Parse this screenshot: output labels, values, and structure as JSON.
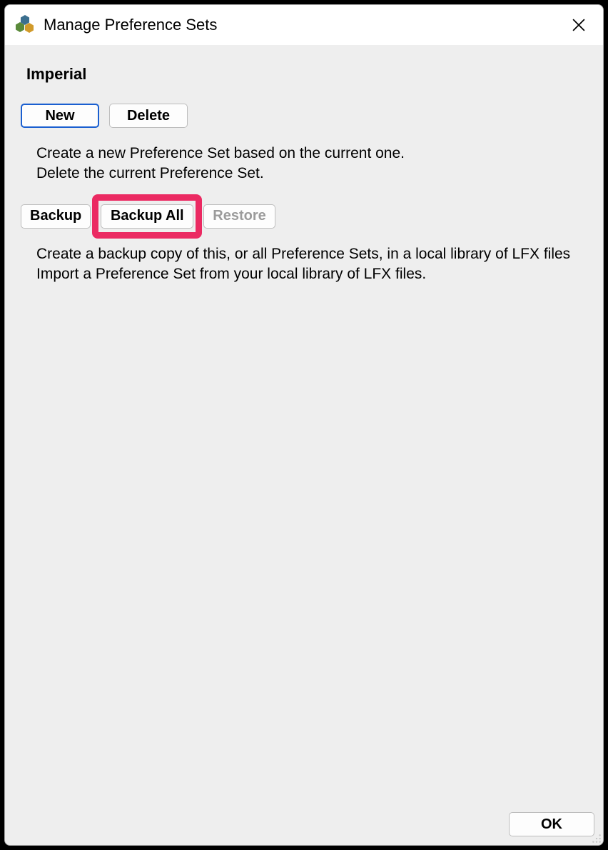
{
  "window": {
    "title": "Manage Preference Sets"
  },
  "section": {
    "current_set": "Imperial"
  },
  "buttons": {
    "new": "New",
    "delete": "Delete",
    "backup": "Backup",
    "backup_all": "Backup All",
    "restore": "Restore",
    "ok": "OK"
  },
  "descriptions": {
    "new_delete": "Create a new Preference Set based on the current one.\nDelete the current Preference Set.",
    "backup_restore": "Create a backup copy of this, or all Preference Sets, in a local library of LFX files\nImport a Preference Set from your local library of LFX files."
  },
  "highlight": {
    "target": "backup_all"
  }
}
